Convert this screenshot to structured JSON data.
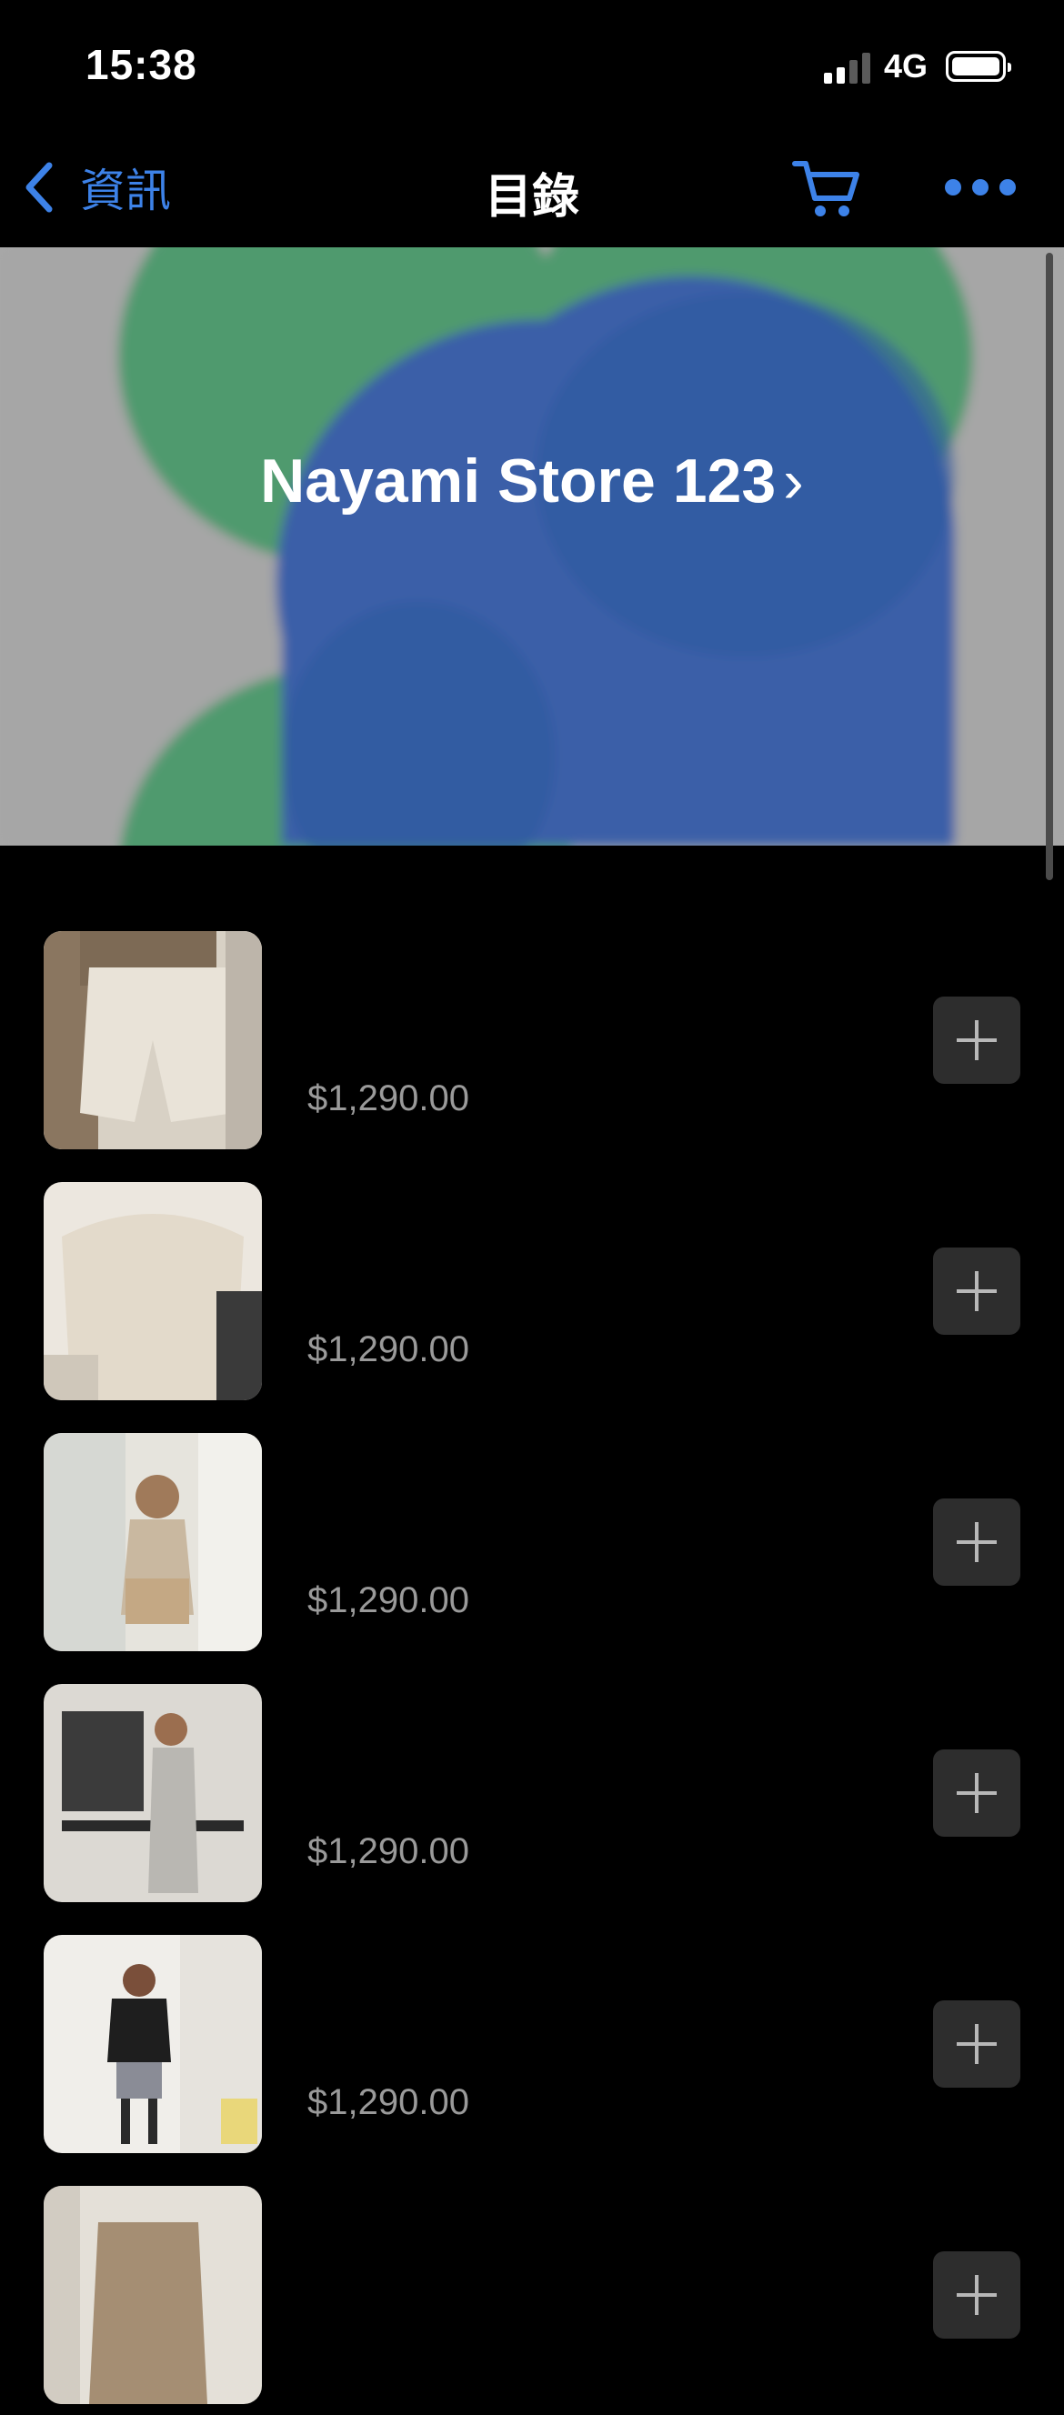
{
  "status_bar": {
    "time": "15:38",
    "network": "4G"
  },
  "nav": {
    "back_label": "資訊",
    "title": "目錄",
    "back_icon": "chevron-left-icon",
    "cart_icon": "cart-icon",
    "more_icon": "more-icon"
  },
  "banner": {
    "title": "Nayami Store 123",
    "chevron": "›"
  },
  "colors": {
    "accent": "#3d82e8",
    "banner_green": "#4f9a6e",
    "banner_blue": "#3a5ea8"
  },
  "products": [
    {
      "price": "$1,290.00"
    },
    {
      "price": "$1,290.00"
    },
    {
      "price": "$1,290.00"
    },
    {
      "price": "$1,290.00"
    },
    {
      "price": "$1,290.00"
    },
    {
      "price": ""
    }
  ]
}
